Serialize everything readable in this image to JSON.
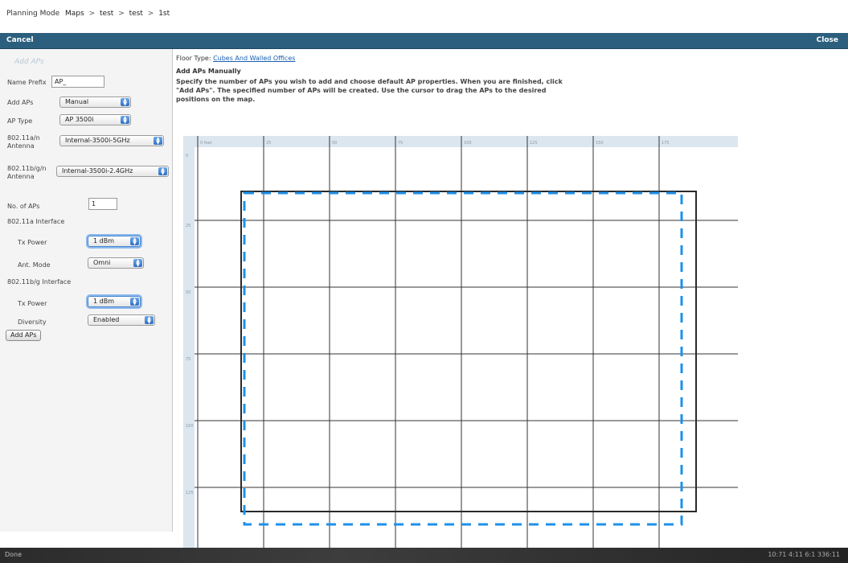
{
  "breadcrumb": {
    "mode": "Planning Mode",
    "items": [
      "Maps",
      "test",
      "test",
      "1st"
    ],
    "separator": ">"
  },
  "toolbar": {
    "cancel_label": "Cancel",
    "close_label": "Close"
  },
  "sidebar": {
    "heading": "Add APs",
    "name_prefix": {
      "label": "Name Prefix",
      "value": "AP_"
    },
    "add_aps": {
      "label": "Add APs",
      "value": "Manual"
    },
    "ap_type": {
      "label": "AP Type",
      "value": "AP 3500i"
    },
    "antenna_a": {
      "label_line1": "802.11a/n",
      "label_line2": "Antenna",
      "value": "Internal-3500i-5GHz"
    },
    "antenna_bg": {
      "label_line1": "802.11b/g/n",
      "label_line2": "Antenna",
      "value": "Internal-3500i-2.4GHz"
    },
    "num_aps": {
      "label": "No. of APs",
      "value": "1"
    },
    "iface_a": {
      "title": "802.11a Interface",
      "tx_label": "Tx Power",
      "tx_value": "1 dBm",
      "ant_mode_label": "Ant. Mode",
      "ant_mode_value": "Omni"
    },
    "iface_bg": {
      "title": "802.11b/g Interface",
      "tx_label": "Tx Power",
      "tx_value": "1 dBm",
      "diversity_label": "Diversity",
      "diversity_value": "Enabled"
    },
    "add_button": "Add APs"
  },
  "main": {
    "floor_type_label": "Floor Type:",
    "floor_type_value": "Cubes And Walled Offices",
    "instructions_title": "Add APs Manually",
    "instructions_text": "Specify the number of APs you wish to add and choose default AP properties. When you are finished, click \"Add APs\". The specified number of APs will be created. Use the cursor to drag the APs to the desired positions on the map."
  },
  "map": {
    "ruler_x": [
      "0 feet",
      "25",
      "50",
      "75",
      "100",
      "125",
      "150",
      "175"
    ],
    "ruler_y": [
      "0",
      "25",
      "50",
      "75",
      "100",
      "125"
    ],
    "outline_color": "#2a2a2a",
    "dashed_color": "#1e90e8"
  },
  "taskbar": {
    "start_label": "Done",
    "clock": "10:71 4:11 6:1 336:11"
  }
}
